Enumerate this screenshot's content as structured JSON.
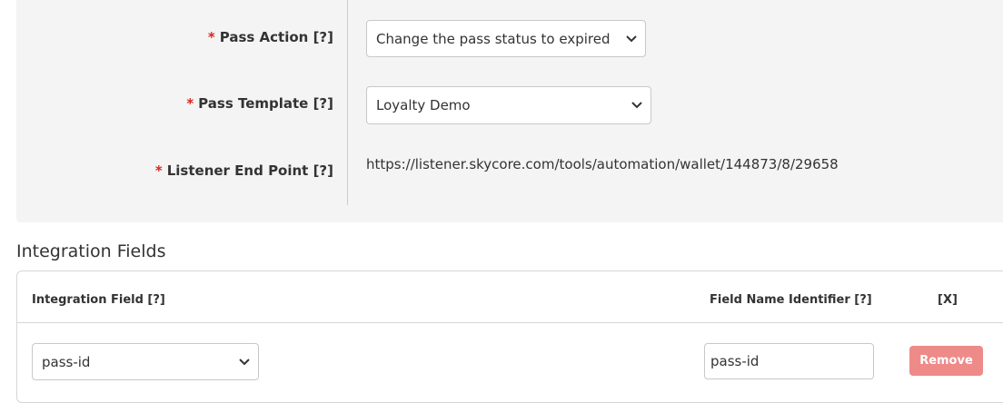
{
  "form": {
    "required_marker": "*",
    "pass_action": {
      "label": "Pass Action [?]",
      "value": "Change the pass status to expired"
    },
    "pass_template": {
      "label": "Pass Template [?]",
      "value": "Loyalty Demo"
    },
    "listener_end_point": {
      "label": "Listener End Point [?]",
      "value": "https://listener.skycore.com/tools/automation/wallet/144873/8/29658"
    }
  },
  "integration": {
    "title": "Integration Fields",
    "headers": {
      "integration_field": "Integration Field [?]",
      "field_name_identifier": "Field Name Identifier [?]",
      "remove": "[X]"
    },
    "rows": [
      {
        "integration_field": "pass-id",
        "field_name_identifier": "pass-id",
        "remove_label": "Remove"
      }
    ]
  },
  "icons": {
    "dropdown": "chevron-down-icon"
  },
  "colors": {
    "required": "#d9261c",
    "remove_button": "#ee8a88",
    "panel_bg": "#f4f4f4"
  }
}
